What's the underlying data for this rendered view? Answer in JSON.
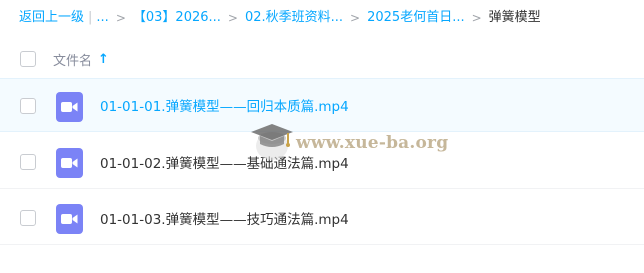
{
  "breadcrumb": {
    "back_label": "返回上一级",
    "pipe": "|",
    "ellipsis": "...",
    "separator": ">",
    "items": [
      {
        "label": "【03】2026..."
      },
      {
        "label": "02.秋季班资料..."
      },
      {
        "label": "2025老何首日..."
      }
    ],
    "current": "弹簧模型"
  },
  "list_header": {
    "column_label": "文件名",
    "sort_icon": "arrow-up-icon",
    "sort_glyph": "↑"
  },
  "files": [
    {
      "name": "01-01-01.弹簧模型——回归本质篇.mp4",
      "icon": "video-file-icon",
      "hovered": true
    },
    {
      "name": "01-01-02.弹簧模型——基础通法篇.mp4",
      "icon": "video-file-icon",
      "hovered": false
    },
    {
      "name": "01-01-03.弹簧模型——技巧通法篇.mp4",
      "icon": "video-file-icon",
      "hovered": false
    }
  ],
  "watermark": {
    "text": "www.xue-ba.org",
    "icon": "graduation-cap-icon"
  },
  "colors": {
    "accent": "#06a7ff",
    "video_icon": "#7b83f6",
    "hover_row": "#f4fbff",
    "watermark": "#c6b79a"
  }
}
